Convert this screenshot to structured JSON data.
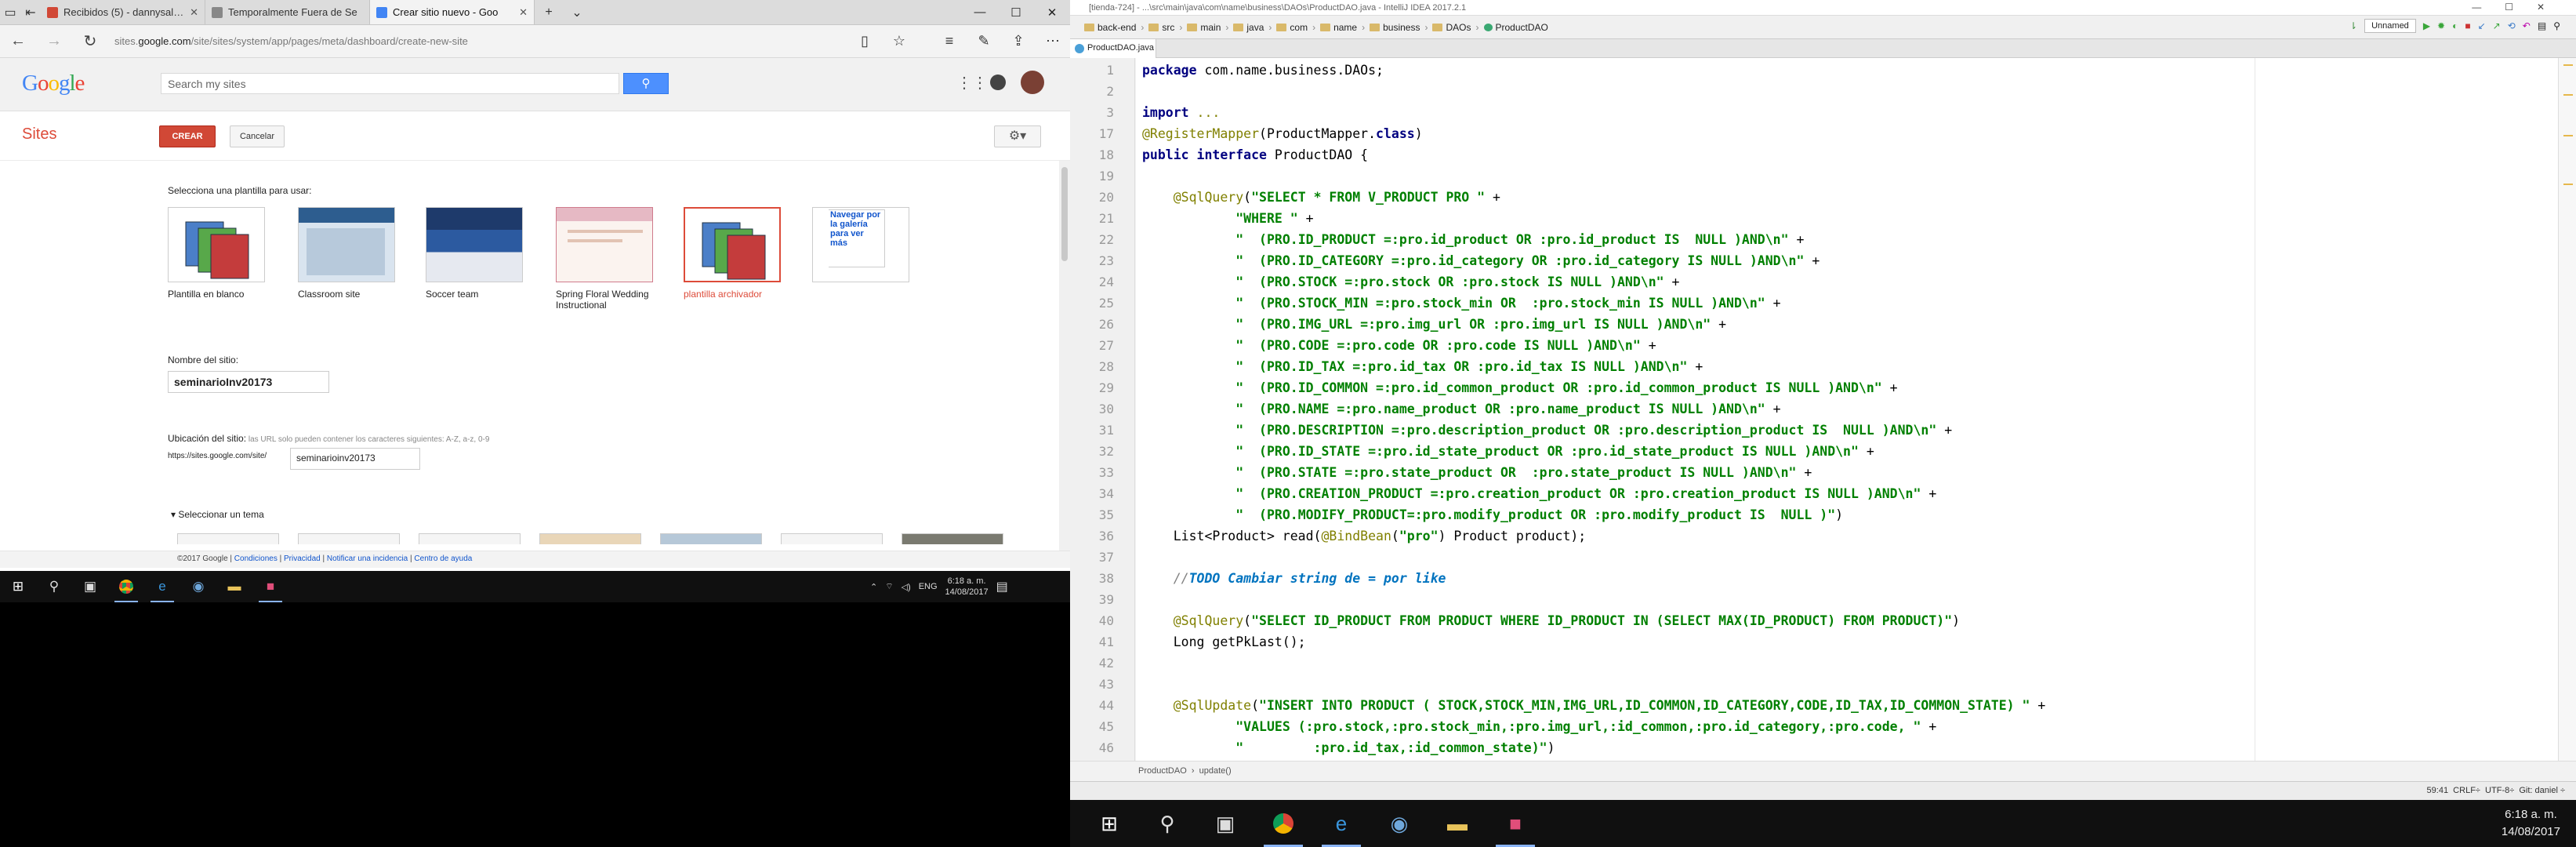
{
  "browser": {
    "tabs": [
      {
        "label": "Recibidos (5) - dannysalazar",
        "active": false,
        "favicon_color": "#d14836"
      },
      {
        "label": "Temporalmente Fuera de Se",
        "active": false,
        "favicon_color": "#888888"
      },
      {
        "label": "Crear sitio nuevo - Goo",
        "active": true,
        "favicon_color": "#4285f4"
      }
    ],
    "url_prefix": "sites.",
    "url_domain": "google.com",
    "url_path": "/site/sites/system/app/pages/meta/dashboard/create-new-site"
  },
  "sites": {
    "logo": "Google",
    "search_placeholder": "Search my sites",
    "brand": "Sites",
    "create_label": "CREAR",
    "cancel_label": "Cancelar",
    "template_prompt": "Selecciona una plantilla para usar:",
    "templates": [
      {
        "name": "Plantilla en blanco",
        "selected": false
      },
      {
        "name": "Classroom site",
        "selected": false
      },
      {
        "name": "Soccer team",
        "selected": false
      },
      {
        "name": "Spring Floral Wedding Instructional",
        "selected": false
      },
      {
        "name": "plantilla archivador",
        "selected": true
      }
    ],
    "gallery_link": "Navegar por la galería para ver más",
    "name_label": "Nombre del sitio:",
    "name_value": "seminarioInv20173",
    "location_label": "Ubicación del sitio:",
    "location_hint": " las URL solo pueden contener los caracteres siguientes: A-Z, a-z, 0-9",
    "location_prefix": "https://sites.google.com/site/",
    "location_value": "seminarioinv20173",
    "theme_toggle": "Seleccionar un tema",
    "footer_copyright": "©2017 Google | ",
    "footer_links": [
      "Condiciones",
      "Privacidad",
      "Notificar una incidencia",
      "Centro de ayuda"
    ]
  },
  "taskbar_left": {
    "lang": "ENG",
    "time": "6:18 a. m.",
    "date": "14/08/2017"
  },
  "ide": {
    "title": "[tienda-724] - ...\\src\\main\\java\\com\\name\\business\\DAOs\\ProductDAO.java - IntelliJ IDEA 2017.2.1",
    "breadcrumbs": [
      "back-end",
      "src",
      "main",
      "java",
      "com",
      "name",
      "business",
      "DAOs",
      "ProductDAO"
    ],
    "run_config": "Unnamed",
    "file_tab": "ProductDAO.java",
    "line_numbers": [
      "1",
      "2",
      "3",
      "17",
      "18",
      "19",
      "20",
      "21",
      "22",
      "23",
      "24",
      "25",
      "26",
      "27",
      "28",
      "29",
      "30",
      "31",
      "32",
      "33",
      "34",
      "35",
      "36",
      "37",
      "38",
      "39",
      "40",
      "41",
      "42",
      "43",
      "44",
      "45",
      "46"
    ],
    "code_breadcrumb": [
      "ProductDAO",
      "update()"
    ],
    "status": "59:41  CRLF÷  UTF-8÷  Git: daniel ÷"
  },
  "taskbar_right": {
    "time": "6:18 a. m.",
    "date": "14/08/2017"
  },
  "icons": {
    "search": "search-icon",
    "gear": "gear-icon",
    "apps": "apps-grid-icon"
  }
}
